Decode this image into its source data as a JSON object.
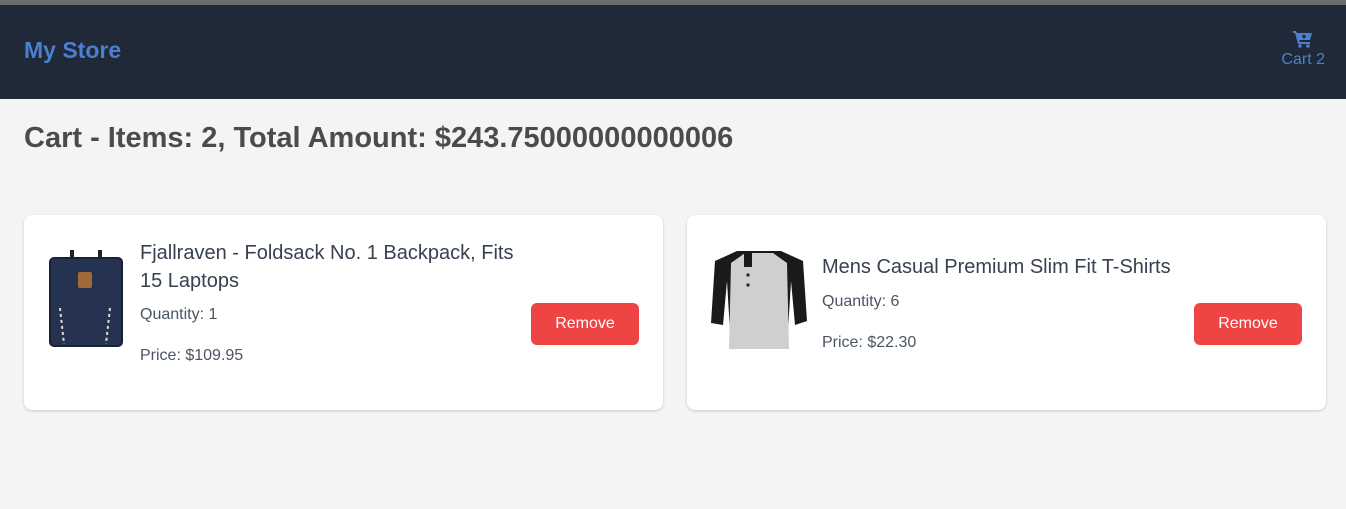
{
  "navbar": {
    "brand": "My Store",
    "cart_label": "Cart 2",
    "cart_icon": "shopping-cart-icon"
  },
  "heading": "Cart - Items: 2, Total Amount: $243.75000000000006",
  "items": [
    {
      "title": "Fjallraven - Foldsack No. 1 Backpack, Fits 15 Laptops",
      "quantity": "Quantity: 1",
      "price": "Price: $109.95",
      "remove_label": "Remove",
      "image": "backpack-image"
    },
    {
      "title": "Mens Casual Premium Slim Fit T-Shirts",
      "quantity": "Quantity: 6",
      "price": "Price: $22.30",
      "remove_label": "Remove",
      "image": "tshirt-image"
    }
  ],
  "colors": {
    "navbar_bg": "#1f2937",
    "brand": "#4a7fd1",
    "page_bg": "#f3f4f6",
    "remove_button": "#ef4444"
  }
}
